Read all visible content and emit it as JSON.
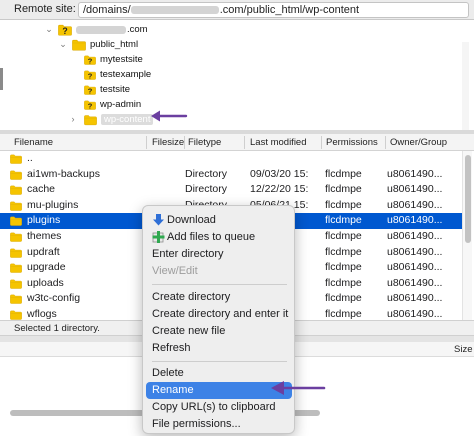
{
  "remote_site": {
    "label": "Remote site:",
    "path_prefix": "/domains/",
    "path_suffix": ".com/public_html/wp-content"
  },
  "tree": {
    "items": [
      {
        "label": ".com",
        "icon": "question-folder-icon"
      },
      {
        "label": "public_html",
        "icon": "folder-icon"
      },
      {
        "label": "mytestsite",
        "icon": "question-folder-icon"
      },
      {
        "label": "testexample",
        "icon": "question-folder-icon"
      },
      {
        "label": "testsite",
        "icon": "question-folder-icon"
      },
      {
        "label": "wp-admin",
        "icon": "question-folder-icon"
      },
      {
        "label": "wp-content",
        "icon": "folder-icon"
      }
    ]
  },
  "file_list": {
    "columns": [
      "Filename",
      "Filesize",
      "Filetype",
      "Last modified",
      "Permissions",
      "Owner/Group"
    ],
    "rows": [
      {
        "name": "..",
        "filesize": "",
        "filetype": "",
        "modified": "",
        "permissions": "",
        "owner": ""
      },
      {
        "name": "ai1wm-backups",
        "filesize": "",
        "filetype": "Directory",
        "modified": "09/03/20 15:",
        "permissions": "flcdmpe",
        "owner": "u8061490..."
      },
      {
        "name": "cache",
        "filesize": "",
        "filetype": "Directory",
        "modified": "12/22/20 15:",
        "permissions": "flcdmpe",
        "owner": "u8061490..."
      },
      {
        "name": "mu-plugins",
        "filesize": "",
        "filetype": "Directory",
        "modified": "05/06/21 15:",
        "permissions": "flcdmpe",
        "owner": "u8061490..."
      },
      {
        "name": "plugins",
        "filesize": "",
        "filetype": "",
        "modified": "15:",
        "permissions": "flcdmpe",
        "owner": "u8061490..."
      },
      {
        "name": "themes",
        "filesize": "",
        "filetype": "",
        "modified": "15:",
        "permissions": "flcdmpe",
        "owner": "u8061490..."
      },
      {
        "name": "updraft",
        "filesize": "",
        "filetype": "",
        "modified": "15:",
        "permissions": "flcdmpe",
        "owner": "u8061490..."
      },
      {
        "name": "upgrade",
        "filesize": "",
        "filetype": "",
        "modified": "15:",
        "permissions": "flcdmpe",
        "owner": "u8061490..."
      },
      {
        "name": "uploads",
        "filesize": "",
        "filetype": "",
        "modified": "15:",
        "permissions": "flcdmpe",
        "owner": "u8061490..."
      },
      {
        "name": "w3tc-config",
        "filesize": "",
        "filetype": "",
        "modified": "15:",
        "permissions": "flcdmpe",
        "owner": "u8061490..."
      },
      {
        "name": "wflogs",
        "filesize": "",
        "filetype": "",
        "modified": "15:",
        "permissions": "flcdmpe",
        "owner": "u8061490..."
      }
    ],
    "selected_index": 4
  },
  "status": {
    "text": "Selected 1 directory."
  },
  "queue": {
    "size_header": "Size"
  },
  "context_menu": {
    "download": "Download",
    "add_to_queue": "Add files to queue",
    "enter_directory": "Enter directory",
    "view_edit": "View/Edit",
    "create_directory": "Create directory",
    "create_and_enter": "Create directory and enter it",
    "create_file": "Create new file",
    "refresh": "Refresh",
    "delete": "Delete",
    "rename": "Rename",
    "copy_url": "Copy URL(s) to clipboard",
    "file_permissions": "File permissions..."
  },
  "colors": {
    "selection": "#0058d0",
    "menu_highlight": "#3d82e6",
    "annotation_arrow": "#6b3fa0",
    "folder": "#f5c400"
  }
}
